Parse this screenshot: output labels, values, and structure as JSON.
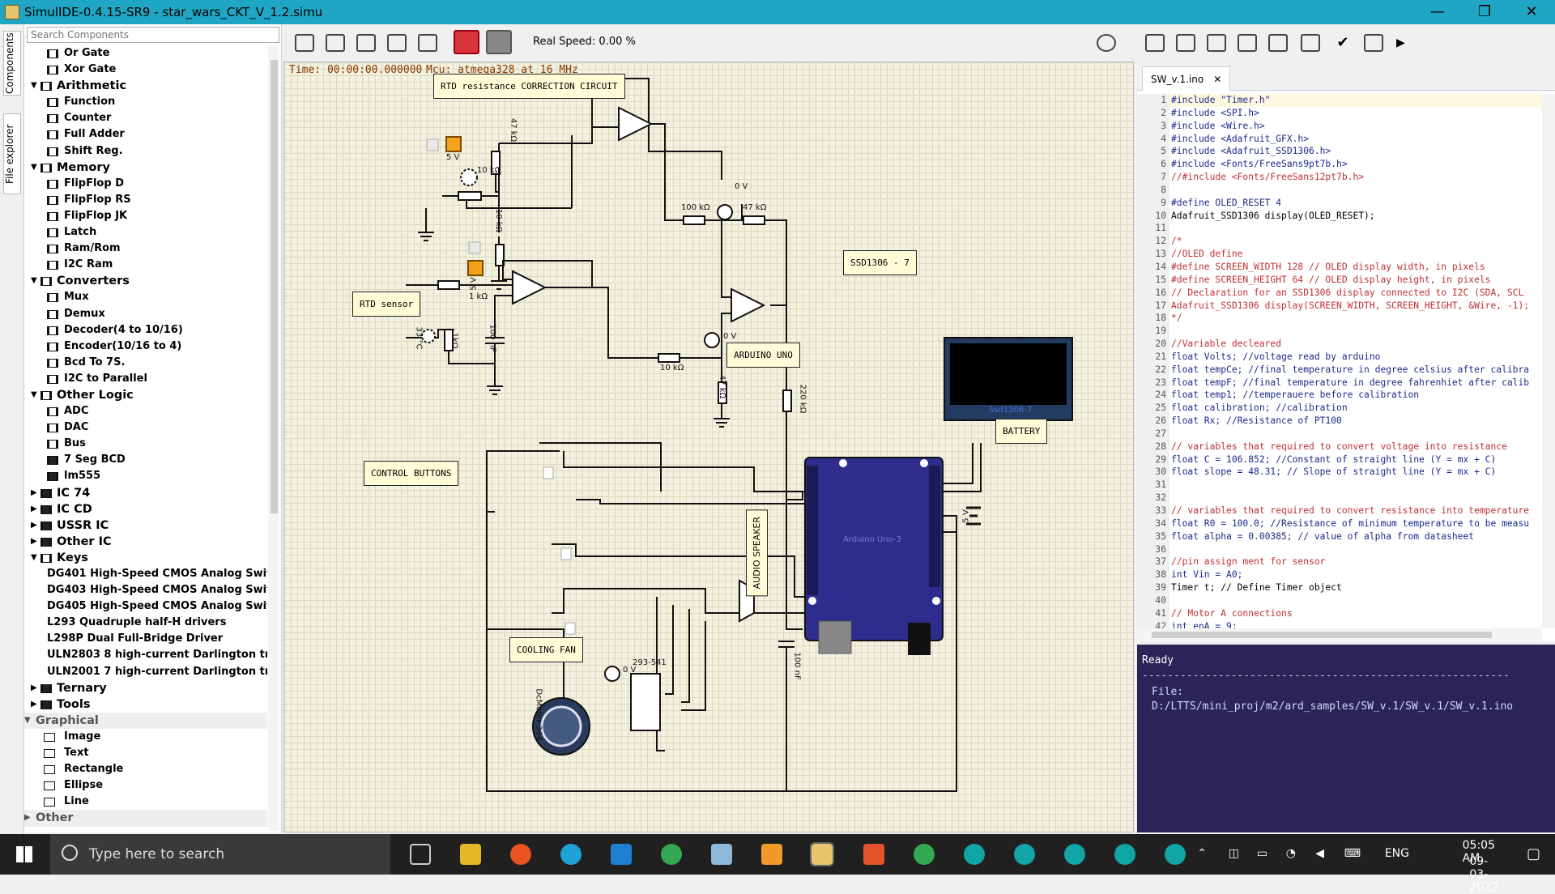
{
  "app": {
    "title": "SimulIDE-0.4.15-SR9  -  star_wars_CKT_V_1.2.simu",
    "minimize": "—",
    "maximize": "❐",
    "close": "✕"
  },
  "sidetabs": [
    "Components",
    "File explorer"
  ],
  "search": {
    "placeholder": "Search Components"
  },
  "tree": [
    {
      "label": "Or Gate",
      "level": 2
    },
    {
      "label": "Xor Gate",
      "level": 2
    },
    {
      "label": "Arithmetic",
      "level": 1,
      "expanded": true
    },
    {
      "label": "Function",
      "level": 2
    },
    {
      "label": "Counter",
      "level": 2
    },
    {
      "label": "Full Adder",
      "level": 2
    },
    {
      "label": "Shift Reg.",
      "level": 2
    },
    {
      "label": "Memory",
      "level": 1,
      "expanded": true
    },
    {
      "label": "FlipFlop D",
      "level": 2
    },
    {
      "label": "FlipFlop RS",
      "level": 2
    },
    {
      "label": "FlipFlop JK",
      "level": 2
    },
    {
      "label": "Latch",
      "level": 2
    },
    {
      "label": "Ram/Rom",
      "level": 2
    },
    {
      "label": "I2C Ram",
      "level": 2
    },
    {
      "label": "Converters",
      "level": 1,
      "expanded": true
    },
    {
      "label": "Mux",
      "level": 2
    },
    {
      "label": "Demux",
      "level": 2
    },
    {
      "label": "Decoder(4 to 10/16)",
      "level": 2
    },
    {
      "label": "Encoder(10/16 to 4)",
      "level": 2
    },
    {
      "label": "Bcd To 7S.",
      "level": 2
    },
    {
      "label": "I2C to Parallel",
      "level": 2
    },
    {
      "label": "Other Logic",
      "level": 1,
      "expanded": true
    },
    {
      "label": "ADC",
      "level": 2
    },
    {
      "label": "DAC",
      "level": 2
    },
    {
      "label": "Bus",
      "level": 2
    },
    {
      "label": "7 Seg BCD",
      "level": 2
    },
    {
      "label": "lm555",
      "level": 2
    },
    {
      "label": "IC 74",
      "level": 1,
      "expanded": false
    },
    {
      "label": "IC CD",
      "level": 1,
      "expanded": false
    },
    {
      "label": "USSR IC",
      "level": 1,
      "expanded": false
    },
    {
      "label": "Other IC",
      "level": 1,
      "expanded": false
    },
    {
      "label": "Keys",
      "level": 1,
      "expanded": true
    },
    {
      "label": "DG401 High-Speed CMOS Analog Switc...",
      "level": 3
    },
    {
      "label": "DG403 High-Speed CMOS Analog Switc...",
      "level": 3
    },
    {
      "label": "DG405 High-Speed CMOS Analog Switc...",
      "level": 3
    },
    {
      "label": "L293 Quadruple half-H drivers",
      "level": 3
    },
    {
      "label": "L298P Dual Full-Bridge Driver",
      "level": 3
    },
    {
      "label": "ULN2803 8 high-current Darlington tra...",
      "level": 3
    },
    {
      "label": "ULN2001 7 high-current Darlington tra...",
      "level": 3
    },
    {
      "label": "Ternary",
      "level": 1,
      "expanded": false
    },
    {
      "label": "Tools",
      "level": 1,
      "expanded": false
    }
  ],
  "graphical": {
    "label": "Graphical",
    "items": [
      "Image",
      "Text",
      "Rectangle",
      "Ellipse",
      "Line"
    ],
    "icons": [
      "image-icon",
      "text-icon",
      "rectangle-icon",
      "ellipse-icon",
      "line-icon"
    ]
  },
  "other": {
    "label": "Other"
  },
  "toolbar": {
    "real_speed": "Real Speed: 0.00 %"
  },
  "status": {
    "time": "Time: 00:00:00.000000",
    "mcu": "Mcu: atmega328 at 16 MHz"
  },
  "circuit": {
    "labels": {
      "rtd_circuit": "RTD resistance CORRECTION CIRCUIT",
      "rtd_sensor": "RTD sensor",
      "ssd": "SSD1306 - 7",
      "arduino": "ARDUINO UNO",
      "battery": "BATTERY",
      "control_buttons": "CONTROL BUTTONS",
      "cooling_fan": "COOLING FAN",
      "audio_speaker": "AUDIO SPEAKER"
    },
    "values": {
      "v5a": "5 V",
      "v5b": "5 V",
      "r47k_top": "47 kΩ",
      "r10k_pot": "10 kΩ",
      "r10k_v": "10 kΩ",
      "r100k": "100 kΩ",
      "r47k_h": "47 kΩ",
      "ov1": "0 V",
      "ov2": "0 V",
      "ov3": "0 V",
      "r1k": "1 kΩ",
      "c100nf": "100 nF",
      "r10k_b": "10 kΩ",
      "r47k_b": "47 kΩ",
      "r220k": "220 kΩ",
      "temp": "33 °C",
      "rtd_r": "1kΩ",
      "c100nf_b": "100 nF",
      "ic": "293-541",
      "motor": "DcMotor-344",
      "arduino_chip": "Arduino Uno-3",
      "ssd_chip": "Ssd1306-7",
      "bat_v": "5 V"
    }
  },
  "editor": {
    "tab": "SW_v.1.ino",
    "tab_close": "✕",
    "lines": [
      "#include \"Timer.h\"",
      "#include <SPI.h>",
      "#include <Wire.h>",
      "#include <Adafruit_GFX.h>",
      "#include <Adafruit_SSD1306.h>",
      "#include <Fonts/FreeSans9pt7b.h>",
      "//#include <Fonts/FreeSans12pt7b.h>",
      "",
      "#define OLED_RESET 4",
      "Adafruit_SSD1306 display(OLED_RESET);",
      "",
      "/*",
      "//OLED define",
      "#define SCREEN_WIDTH 128 // OLED display width, in pixels",
      "#define SCREEN_HEIGHT 64 // OLED display height, in pixels",
      "// Declaration for an SSD1306 display connected to I2C (SDA, SCL",
      "Adafruit_SSD1306 display(SCREEN_WIDTH, SCREEN_HEIGHT, &Wire, -1);",
      "*/",
      "",
      "//Variable decleared",
      "float Volts; //voltage read by arduino",
      "float tempCe; //final temperature in degree celsius after calibra",
      "float tempF; //final temperature in degree fahrenhiet after calib",
      "float temp1; //temperauere before calibration",
      "float calibration; //calibration",
      "float Rx; //Resistance of PT100",
      "",
      "// variables that required to convert voltage into resistance",
      "float C = 106.852; //Constant of straight line (Y = mx + C)",
      "float slope = 48.31; // Slope of straight line (Y = mx + C)",
      "",
      "",
      "// variables that required to convert resistance into temperature",
      "float R0 = 100.0; //Resistance of minimum temperature to be measu",
      "float alpha = 0.00385; // value of alpha from datasheet",
      "",
      "//pin assign ment for sensor",
      "int Vin = A0;",
      "Timer t; // Define Timer object",
      "",
      "// Motor A connections",
      "int enA = 9;"
    ]
  },
  "console": {
    "status": "Ready",
    "divider": "----------------------------------------------------------",
    "file": "File: D:/LTTS/mini_proj/m2/ard_samples/SW_v.1/SW_v.1/SW_v.1.ino"
  },
  "taskbar": {
    "search": "Type here to search",
    "lang": "ENG",
    "time": "05:05 AM",
    "date": "09-03-2022"
  }
}
